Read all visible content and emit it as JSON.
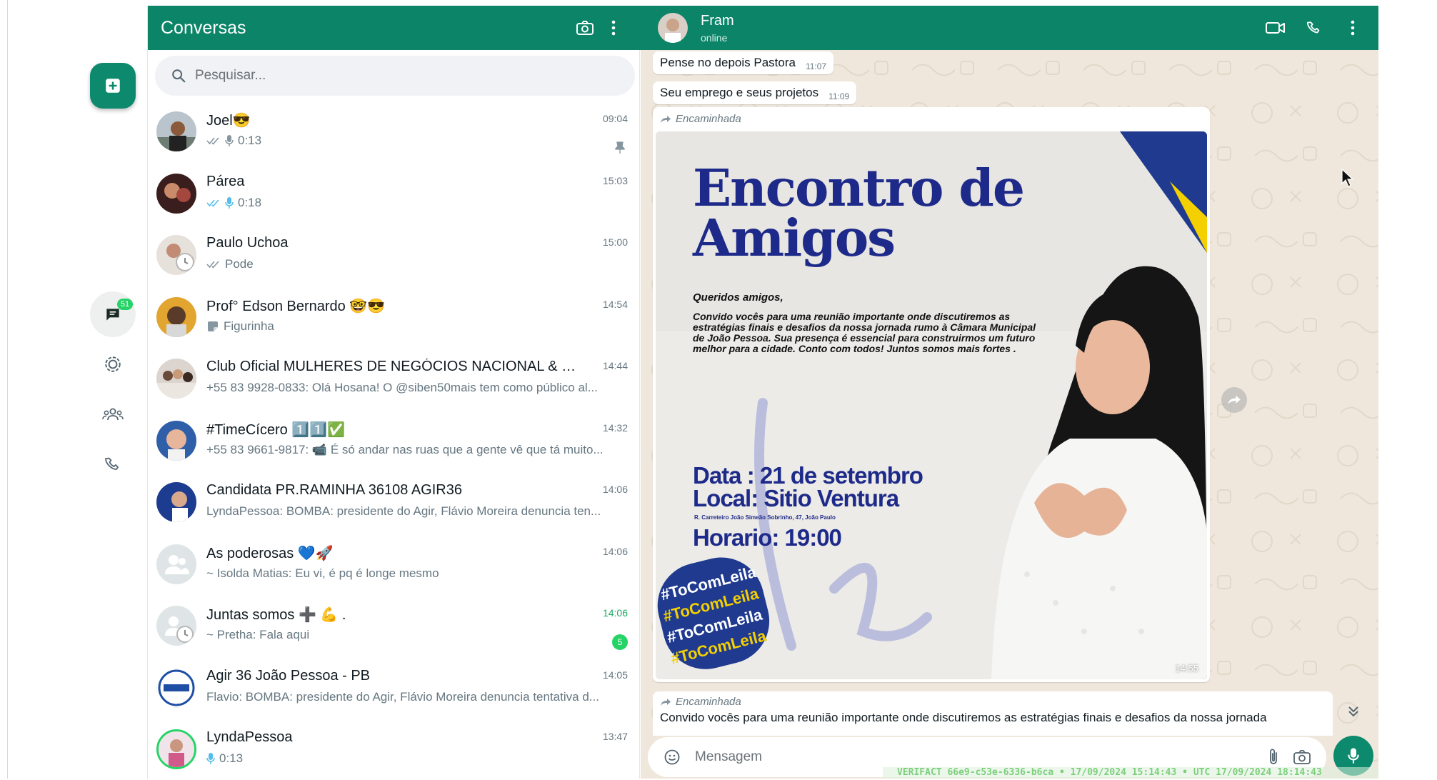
{
  "nav": {
    "chats_badge": "51"
  },
  "list": {
    "title": "Conversas",
    "search_placeholder": "Pesquisar..."
  },
  "chats": [
    {
      "name": "Joel😎",
      "time": "09:04",
      "preview": "0:13",
      "type": "voice",
      "ticks": "read-gray",
      "pinned": true
    },
    {
      "name": "Párea",
      "time": "15:03",
      "preview": "0:18",
      "type": "voice",
      "ticks": "read-blue"
    },
    {
      "name": "Paulo Uchoa",
      "time": "15:00",
      "preview": "Pode",
      "type": "text",
      "ticks": "read-gray"
    },
    {
      "name": "Prof° Edson Bernardo 🤓😎",
      "time": "14:54",
      "preview": "Figurinha",
      "type": "sticker"
    },
    {
      "name": "Club Oficial MULHERES DE NEGÓCIOS NACIONAL & INT...",
      "time": "14:44",
      "preview": "+55 83 9928-0833: Olá Hosana! O @siben50mais tem como público al..."
    },
    {
      "name": "#TimeCícero 1️⃣1️⃣✅",
      "time": "14:32",
      "preview": "+55 83 9661-9817: 📹 É só andar nas ruas que a gente vê que tá muito..."
    },
    {
      "name": "Candidata PR.RAMINHA 36108 AGIR36",
      "time": "14:06",
      "preview": "LyndaPessoa: BOMBA: presidente do Agir, Flávio Moreira denuncia ten..."
    },
    {
      "name": "As poderosas 💙🚀",
      "time": "14:06",
      "preview": "~ Isolda Matias: Eu vi, é pq é longe mesmo"
    },
    {
      "name": "Juntas somos ➕ 💪 .",
      "time": "14:06",
      "preview": "~ Pretha: Fala aqui",
      "unread": "5"
    },
    {
      "name": "Agir 36 João Pessoa - PB",
      "time": "14:05",
      "preview": "Flavio: BOMBA: presidente do Agir, Flávio Moreira denuncia tentativa d..."
    },
    {
      "name": "LyndaPessoa",
      "time": "13:47",
      "preview": "0:13",
      "type": "voice"
    }
  ],
  "conversation": {
    "contact_name": "Fram",
    "contact_status": "online",
    "messages": [
      {
        "text": "Pense no depois Pastora",
        "time": "11:07"
      },
      {
        "text": "Seu emprego e seus projetos",
        "time": "11:09"
      }
    ],
    "forwarded_label": "Encaminhada",
    "image_message": {
      "time": "14:55",
      "poster_title": "Encontro de Amigos",
      "poster_greeting": "Queridos amigos,",
      "poster_body": "Convido vocês para uma reunião importante onde discutiremos as estratégias finais e desafios da nossa jornada rumo à Câmara Municipal de João Pessoa. Sua presença é essencial para construirmos um futuro melhor para a cidade. Conto com todos! Juntos somos mais fortes .",
      "poster_date": "Data : 21 de setembro",
      "poster_local": "Local: Sitio Ventura",
      "poster_address": "R. Carreteiro João Simeão Sobrinho, 47, João Paulo",
      "poster_hour": "Horario: 19:00",
      "poster_tag": "#ToComLeila"
    },
    "last_message_text": "Convido vocês para uma reunião importante onde discutiremos as estratégias finais e desafios da nossa jornada",
    "composer_placeholder": "Mensagem"
  },
  "overlay": {
    "verifact": "VERIFACT 66e9-c53e-6336-b6ca • 17/09/2024 15:14:43 • UTC 17/09/2024 18:14:43"
  },
  "colors": {
    "header_green": "#0b8467",
    "accent_green": "#0d8a6e",
    "unread_green": "#25d366",
    "poster_blue": "#1e2a8a"
  }
}
